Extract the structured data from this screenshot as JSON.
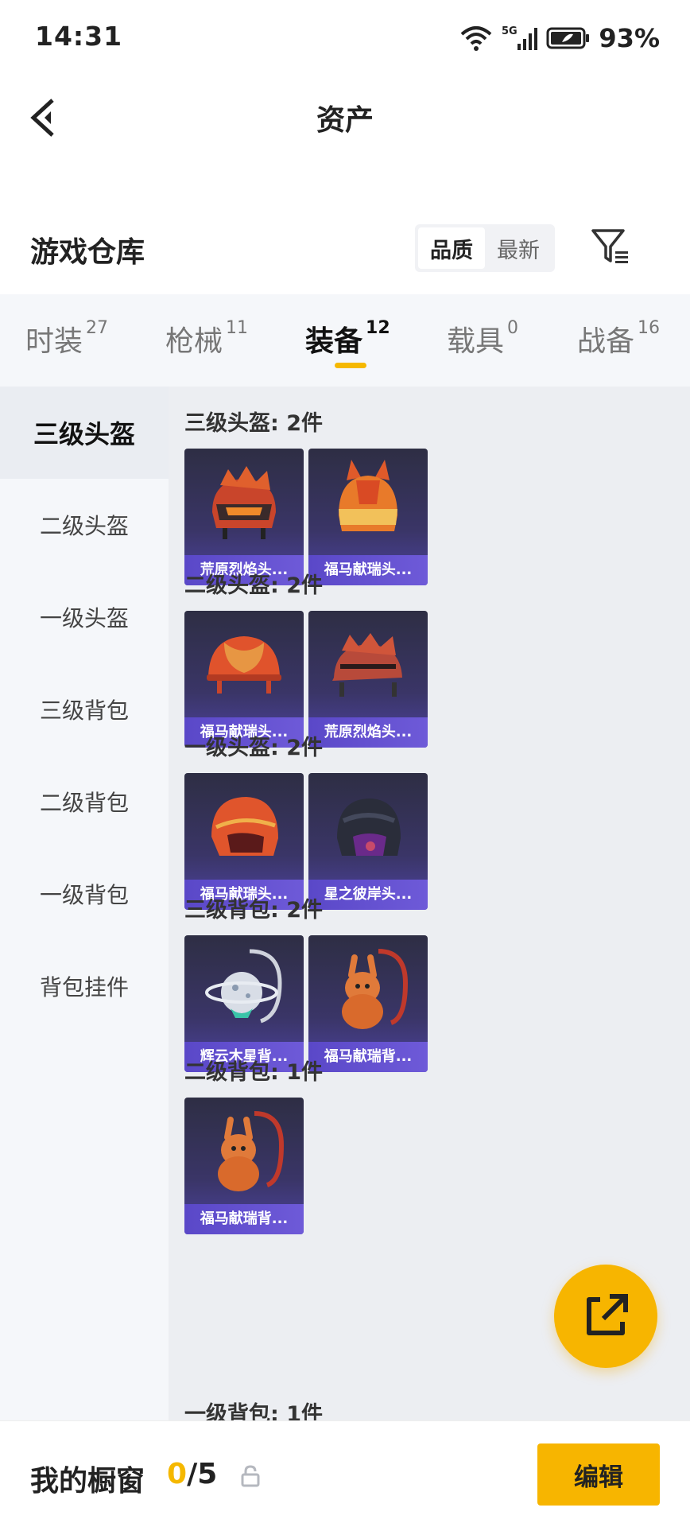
{
  "status_bar": {
    "time": "14:31",
    "network": "5G",
    "battery": "93%"
  },
  "nav": {
    "title": "资产"
  },
  "section": {
    "title": "游戏仓库"
  },
  "sort": {
    "options": [
      "品质",
      "最新"
    ],
    "selected": "品质"
  },
  "tabs": [
    {
      "label": "时装",
      "count": "27"
    },
    {
      "label": "枪械",
      "count": "11"
    },
    {
      "label": "装备",
      "count": "12",
      "active": true
    },
    {
      "label": "载具",
      "count": "0"
    },
    {
      "label": "战备",
      "count": "16"
    }
  ],
  "sidebar": {
    "items": [
      {
        "label": "三级头盔",
        "active": true
      },
      {
        "label": "二级头盔"
      },
      {
        "label": "一级头盔"
      },
      {
        "label": "三级背包"
      },
      {
        "label": "二级背包"
      },
      {
        "label": "一级背包"
      },
      {
        "label": "背包挂件"
      }
    ]
  },
  "groups": [
    {
      "title": "三级头盔: 2件",
      "items": [
        {
          "name": "荒原烈焰头...",
          "icon": "red-flame-helmet-icon"
        },
        {
          "name": "福马献瑞头...",
          "icon": "horse-helmet-icon"
        }
      ]
    },
    {
      "title": "二级头盔: 2件",
      "items": [
        {
          "name": "福马献瑞头...",
          "icon": "red-helmet-icon"
        },
        {
          "name": "荒原烈焰头...",
          "icon": "red-flame-helmet-icon"
        }
      ]
    },
    {
      "title": "一级头盔: 2件",
      "items": [
        {
          "name": "福马献瑞头...",
          "icon": "red-motorcycle-helmet-icon"
        },
        {
          "name": "星之彼岸头...",
          "icon": "dark-helmet-icon"
        }
      ]
    },
    {
      "title": "三级背包: 2件",
      "items": [
        {
          "name": "辉云木星背...",
          "icon": "planet-backpack-icon"
        },
        {
          "name": "福马献瑞背...",
          "icon": "rabbit-backpack-icon"
        }
      ]
    },
    {
      "title": "二级背包: 1件",
      "items": [
        {
          "name": "福马献瑞背...",
          "icon": "rabbit-backpack-icon"
        }
      ]
    },
    {
      "title": "一级背包: 1件",
      "items": []
    }
  ],
  "showcase": {
    "label": "我的橱窗",
    "current": "0",
    "total": "/5",
    "edit_label": "编辑"
  },
  "colors": {
    "accent": "#f7b500",
    "card_label": "#5a48c8"
  }
}
